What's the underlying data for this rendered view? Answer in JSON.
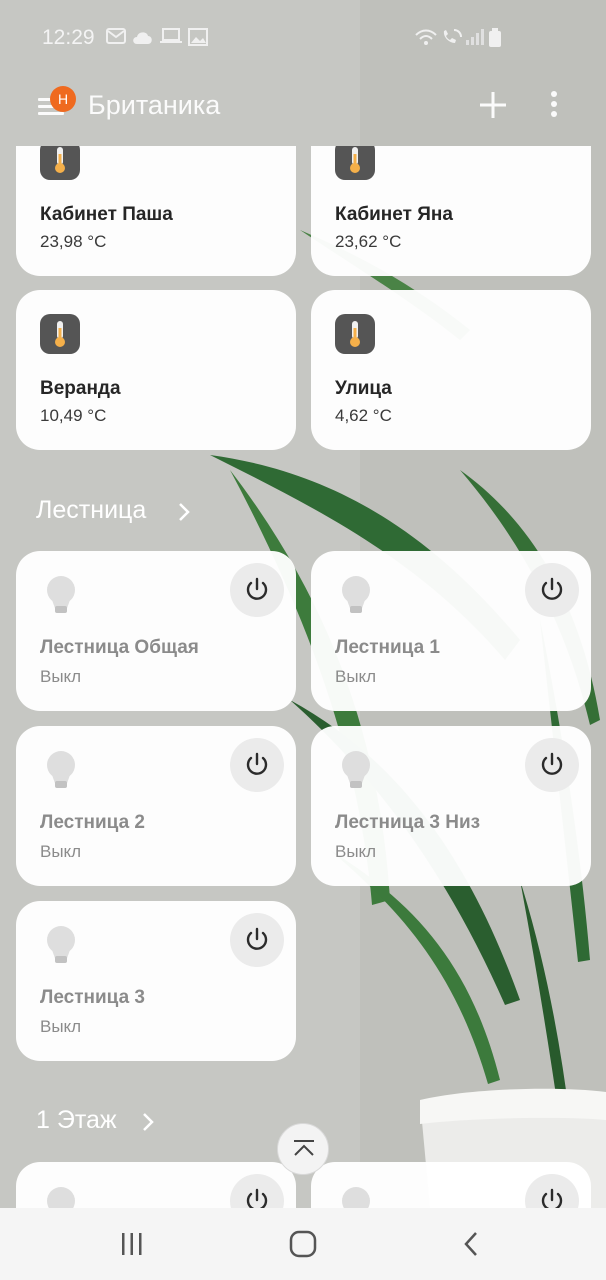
{
  "status_bar": {
    "time": "12:29",
    "icons_left": [
      "gmail-icon",
      "cloud-icon",
      "laptop-icon",
      "image-icon"
    ],
    "icons_right": [
      "wifi-icon",
      "wifi-call-icon",
      "signal-icon",
      "battery-icon"
    ]
  },
  "header": {
    "title": "Британика",
    "badge": "H",
    "menu_icon": "hamburger-icon",
    "add_icon": "plus-icon",
    "more_icon": "more-vertical-icon"
  },
  "sensors": [
    {
      "name": "Кабинет Паша",
      "value": "23,98 °C",
      "icon": "thermometer-icon"
    },
    {
      "name": "Кабинет Яна",
      "value": "23,62 °C",
      "icon": "thermometer-icon"
    },
    {
      "name": "Веранда",
      "value": "10,49 °C",
      "icon": "thermometer-icon"
    },
    {
      "name": "Улица",
      "value": "4,62 °C",
      "icon": "thermometer-icon"
    }
  ],
  "section_stairs": {
    "title": "Лестница",
    "devices": [
      {
        "name": "Лестница Общая",
        "state": "Выкл"
      },
      {
        "name": "Лестница 1",
        "state": "Выкл"
      },
      {
        "name": "Лестница 2",
        "state": "Выкл"
      },
      {
        "name": "Лестница 3 Низ",
        "state": "Выкл"
      },
      {
        "name": "Лестница 3",
        "state": "Выкл"
      }
    ]
  },
  "section_floor1": {
    "title": "1 Этаж"
  },
  "nav": {
    "icons": [
      "recent-apps-icon",
      "home-icon",
      "back-icon"
    ]
  },
  "colors": {
    "badge": "#ef6a1f",
    "thermo_bg": "#555555",
    "thermo_fill": "#f5b04a",
    "card_bg": "#ffffff",
    "off_text": "#8b8b8b"
  }
}
